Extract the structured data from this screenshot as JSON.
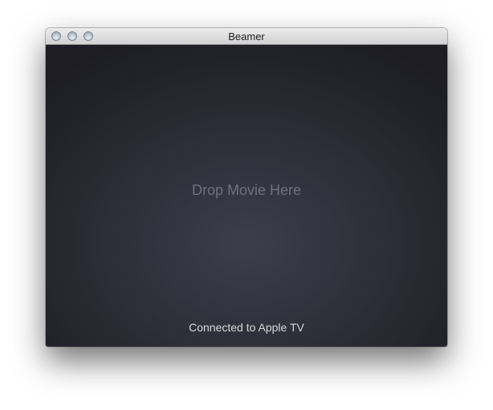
{
  "window": {
    "title": "Beamer",
    "controls": [
      "close",
      "minimize",
      "zoom"
    ]
  },
  "drop_zone": {
    "label": "Drop Movie Here"
  },
  "status": {
    "text": "Connected to Apple TV"
  },
  "colors": {
    "content_background": "#2f2f3a",
    "drop_label": "#6f6f80",
    "status_text": "#d8d8de"
  }
}
